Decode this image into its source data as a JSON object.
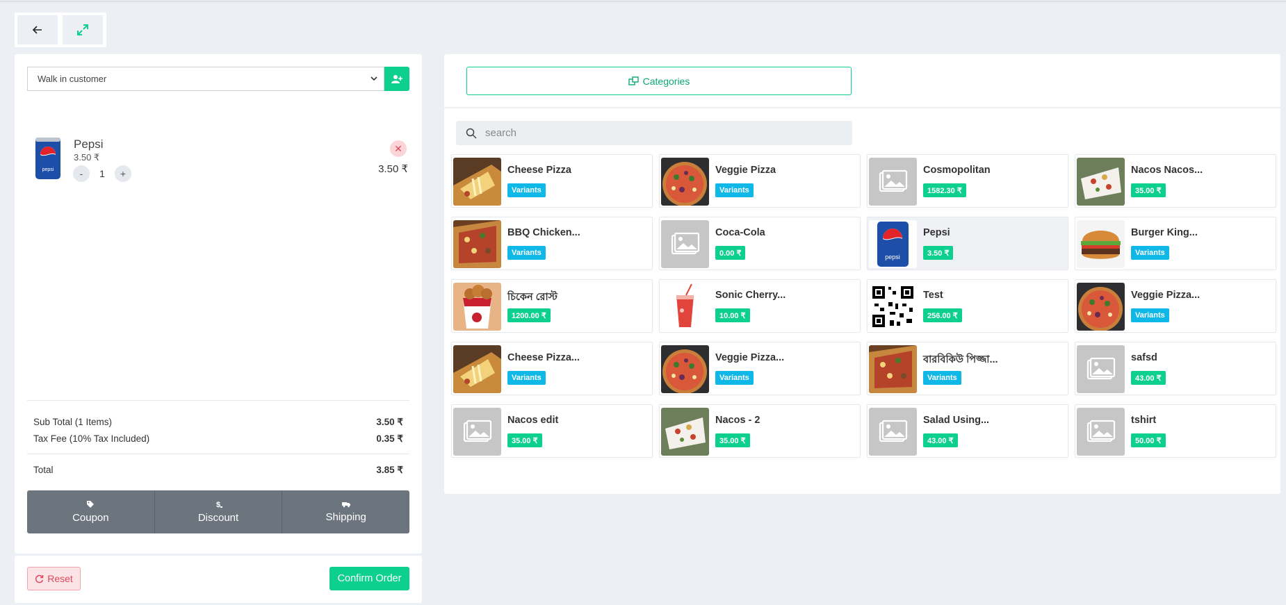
{
  "customer": {
    "selected": "Walk in customer"
  },
  "cart": {
    "items": [
      {
        "name": "Pepsi",
        "price": "3.50 ₹",
        "quantity": "1",
        "line_total": "3.50 ₹",
        "minus": "-",
        "plus": "+"
      }
    ],
    "remove_symbol": "✕"
  },
  "summary": {
    "subtotal_label": "Sub Total (1 Items)",
    "subtotal_value": "3.50 ₹",
    "tax_label": "Tax Fee (10% Tax Included)",
    "tax_value": "0.35 ₹",
    "total_label": "Total",
    "total_value": "3.85 ₹"
  },
  "actions": {
    "coupon": "Coupon",
    "discount": "Discount",
    "shipping": "Shipping"
  },
  "footer": {
    "reset": "Reset",
    "confirm": "Confirm Order"
  },
  "catalog": {
    "categories_label": "Categories",
    "search_placeholder": "search",
    "products": [
      {
        "name": "Cheese Pizza",
        "badge": "Variants",
        "badge_type": "variant",
        "image": "cheese-pizza"
      },
      {
        "name": "Veggie Pizza",
        "badge": "Variants",
        "badge_type": "variant",
        "image": "veggie-pizza"
      },
      {
        "name": "Cosmopolitan",
        "badge": "1582.30 ₹",
        "badge_type": "price",
        "image": "placeholder"
      },
      {
        "name": "Nacos Nacos...",
        "badge": "35.00 ₹",
        "badge_type": "price",
        "image": "nachos"
      },
      {
        "name": "BBQ Chicken...",
        "badge": "Variants",
        "badge_type": "variant",
        "image": "bbq-pizza"
      },
      {
        "name": "Coca-Cola",
        "badge": "0.00 ₹",
        "badge_type": "price",
        "image": "placeholder"
      },
      {
        "name": "Pepsi",
        "badge": "3.50 ₹",
        "badge_type": "price",
        "image": "pepsi"
      },
      {
        "name": "Burger King...",
        "badge": "Variants",
        "badge_type": "variant",
        "image": "burger"
      },
      {
        "name": "চিকেন রোস্ট",
        "badge": "1200.00 ₹",
        "badge_type": "price",
        "image": "chicken-bucket"
      },
      {
        "name": "Sonic Cherry...",
        "badge": "10.00 ₹",
        "badge_type": "price",
        "image": "cherry-drink"
      },
      {
        "name": "Test",
        "badge": "256.00 ₹",
        "badge_type": "price",
        "image": "qr-code"
      },
      {
        "name": "Veggie Pizza...",
        "badge": "Variants",
        "badge_type": "variant",
        "image": "veggie-pizza"
      },
      {
        "name": "Cheese Pizza...",
        "badge": "Variants",
        "badge_type": "variant",
        "image": "cheese-pizza"
      },
      {
        "name": "Veggie Pizza...",
        "badge": "Variants",
        "badge_type": "variant",
        "image": "veggie-pizza"
      },
      {
        "name": "বারবিকিউ পিজ্জা...",
        "badge": "Variants",
        "badge_type": "variant",
        "image": "bbq-pizza"
      },
      {
        "name": "safsd",
        "badge": "43.00 ₹",
        "badge_type": "price",
        "image": "placeholder"
      },
      {
        "name": "Nacos edit",
        "badge": "35.00 ₹",
        "badge_type": "price",
        "image": "placeholder"
      },
      {
        "name": "Nacos - 2",
        "badge": "35.00 ₹",
        "badge_type": "price",
        "image": "nachos"
      },
      {
        "name": "Salad Using...",
        "badge": "43.00 ₹",
        "badge_type": "price",
        "image": "placeholder"
      },
      {
        "name": "tshirt",
        "badge": "50.00 ₹",
        "badge_type": "price",
        "image": "placeholder"
      }
    ],
    "selected_product": "Pepsi"
  },
  "colors": {
    "accent": "#0dcf8e",
    "variant": "#0fb8e6",
    "danger": "#e0475a",
    "dark": "#6c757d"
  }
}
